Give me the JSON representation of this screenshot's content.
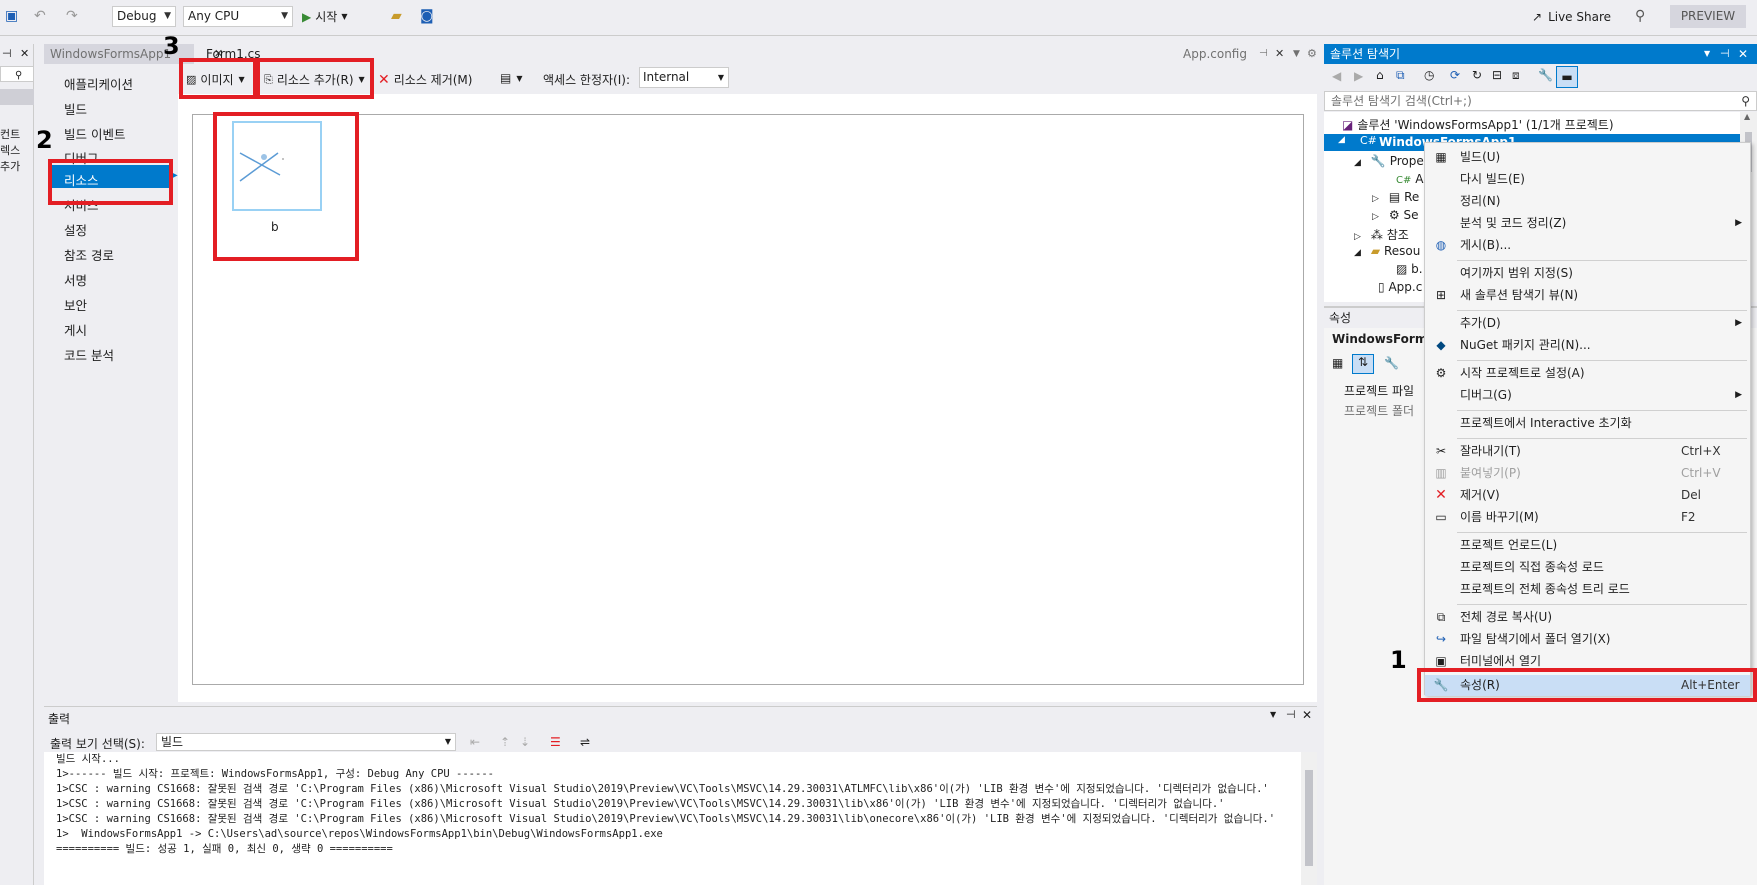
{
  "toolbar": {
    "config": "Debug",
    "platform": "Any CPU",
    "start": "시작",
    "live_share": "Live Share",
    "preview": "PREVIEW"
  },
  "left_strip": [
    "컨트",
    "렉스",
    "추가"
  ],
  "doc_tabs": {
    "project": "WindowsFormsApp1",
    "form": "Form1.cs",
    "appconfig": "App.config"
  },
  "nav": {
    "items": [
      "애플리케이션",
      "빌드",
      "빌드 이벤트",
      "디버그",
      "리소스",
      "서비스",
      "설정",
      "참조 경로",
      "서명",
      "보안",
      "게시",
      "코드 분석"
    ]
  },
  "resource_toolbar": {
    "image": "이미지",
    "add_resource": "리소스 추가(R)",
    "remove_resource": "리소스 제거(M)",
    "access_label": "액세스 한정자(I):",
    "access_value": "Internal"
  },
  "resource_item": {
    "name": "b"
  },
  "output": {
    "title": "출력",
    "select_label": "출력 보기 선택(S):",
    "select_value": "빌드",
    "lines": [
      "빌드 시작...",
      "1>------ 빌드 시작: 프로젝트: WindowsFormsApp1, 구성: Debug Any CPU ------",
      "1>CSC : warning CS1668: 잘못된 검색 경로 'C:\\Program Files (x86)\\Microsoft Visual Studio\\2019\\Preview\\VC\\Tools\\MSVC\\14.29.30031\\ATLMFC\\lib\\x86'이(가) 'LIB 환경 변수'에 지정되었습니다. '디렉터리가 없습니다.'",
      "1>CSC : warning CS1668: 잘못된 검색 경로 'C:\\Program Files (x86)\\Microsoft Visual Studio\\2019\\Preview\\VC\\Tools\\MSVC\\14.29.30031\\lib\\x86'이(가) 'LIB 환경 변수'에 지정되었습니다. '디렉터리가 없습니다.'",
      "1>CSC : warning CS1668: 잘못된 검색 경로 'C:\\Program Files (x86)\\Microsoft Visual Studio\\2019\\Preview\\VC\\Tools\\MSVC\\14.29.30031\\lib\\onecore\\x86'이(가) 'LIB 환경 변수'에 지정되었습니다. '디렉터리가 없습니다.'",
      "1>  WindowsFormsApp1 -> C:\\Users\\ad\\source\\repos\\WindowsFormsApp1\\bin\\Debug\\WindowsFormsApp1.exe",
      "========== 빌드: 성공 1, 실패 0, 최신 0, 생략 0 =========="
    ]
  },
  "solution_explorer": {
    "title": "솔루션 탐색기",
    "search_placeholder": "솔루션 탐색기 검색(Ctrl+;)",
    "solution": "솔루션 'WindowsFormsApp1' (1/1개 프로젝트)",
    "project": "WindowsFormsApp1",
    "items": [
      "Prope",
      "A",
      "Re",
      "Se",
      "참조",
      "Resou",
      "b.",
      "App.c"
    ]
  },
  "properties": {
    "title": "속성",
    "object": "WindowsFormsA",
    "rows": [
      "프로젝트 파일",
      "프로젝트 폴더"
    ]
  },
  "context_menu": {
    "items": [
      {
        "label": "빌드(U)",
        "icon": "build-icon"
      },
      {
        "label": "다시 빌드(E)"
      },
      {
        "label": "정리(N)"
      },
      {
        "label": "분석 및 코드 정리(Z)",
        "submenu": true
      },
      {
        "label": "게시(B)...",
        "icon": "globe-icon"
      },
      {
        "label": "여기까지 범위 지정(S)"
      },
      {
        "label": "새 솔루션 탐색기 뷰(N)",
        "icon": "new-view-icon"
      },
      {
        "label": "추가(D)",
        "submenu": true
      },
      {
        "label": "NuGet 패키지 관리(N)...",
        "icon": "nuget-icon"
      },
      {
        "label": "시작 프로젝트로 설정(A)",
        "icon": "gear-icon"
      },
      {
        "label": "디버그(G)",
        "submenu": true
      },
      {
        "label": "프로젝트에서 Interactive 초기화"
      },
      {
        "label": "잘라내기(T)",
        "shortcut": "Ctrl+X",
        "icon": "scissors-icon"
      },
      {
        "label": "붙여넣기(P)",
        "shortcut": "Ctrl+V",
        "icon": "paste-icon",
        "disabled": true
      },
      {
        "label": "제거(V)",
        "shortcut": "Del",
        "icon": "delete-icon"
      },
      {
        "label": "이름 바꾸기(M)",
        "shortcut": "F2",
        "icon": "rename-icon"
      },
      {
        "label": "프로젝트 언로드(L)"
      },
      {
        "label": "프로젝트의 직접 종속성 로드"
      },
      {
        "label": "프로젝트의 전체 종속성 트리 로드"
      },
      {
        "label": "전체 경로 복사(U)",
        "icon": "copy-icon"
      },
      {
        "label": "파일 탐색기에서 폴더 열기(X)",
        "icon": "folder-open-icon"
      },
      {
        "label": "터미널에서 열기",
        "icon": "terminal-icon"
      },
      {
        "label": "속성(R)",
        "shortcut": "Alt+Enter",
        "icon": "wrench-icon"
      }
    ]
  },
  "annotations": [
    "1",
    "2",
    "3"
  ]
}
